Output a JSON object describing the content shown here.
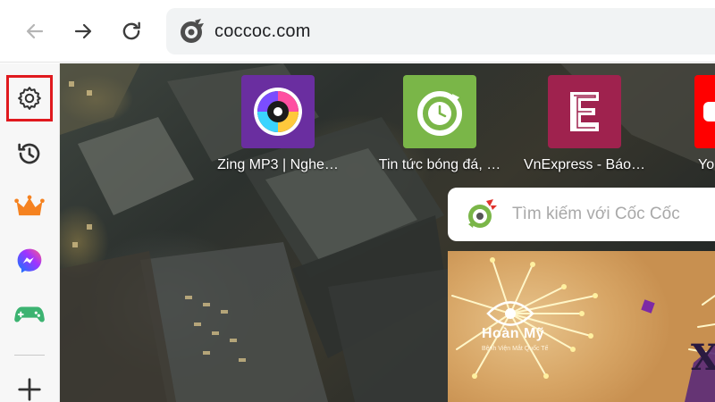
{
  "browser": {
    "nav": {
      "back": "back-arrow-icon",
      "forward": "forward-arrow-icon",
      "reload": "reload-icon"
    },
    "address_bar": {
      "url": "coccoc.com",
      "site_icon": "coccoc-logo-icon"
    }
  },
  "sidebar": {
    "items": [
      {
        "name": "settings",
        "icon": "gear-icon",
        "highlighted": true,
        "highlight_color": "#e0191e"
      },
      {
        "name": "history",
        "icon": "history-icon"
      },
      {
        "name": "rewards",
        "icon": "crown-icon",
        "color": "#f58220"
      },
      {
        "name": "messenger",
        "icon": "messenger-icon"
      },
      {
        "name": "games",
        "icon": "gamepad-icon",
        "color": "#3cb371"
      },
      {
        "name": "add",
        "icon": "plus-icon"
      }
    ]
  },
  "newtab": {
    "shortcuts": [
      {
        "title": "Zing MP3 | Nghe…",
        "icon": "zing-mp3-icon",
        "color": "#6a2ea0"
      },
      {
        "title": "Tin tức bóng đá, …",
        "icon": "football-news-icon",
        "color": "#7ab648"
      },
      {
        "title": "VnExpress - Báo…",
        "icon": "vnexpress-icon",
        "color": "#9f224e"
      },
      {
        "title": "Yo",
        "icon": "youtube-icon",
        "color": "#ff0000"
      }
    ],
    "search": {
      "placeholder": "Tìm kiếm với Cốc Cốc",
      "icon": "coccoc-search-logo-icon"
    },
    "ad": {
      "brand": "Hoàn Mỹ",
      "subtitle": "Bệnh Viện Mắt Quốc Tế",
      "letter": "X"
    }
  }
}
